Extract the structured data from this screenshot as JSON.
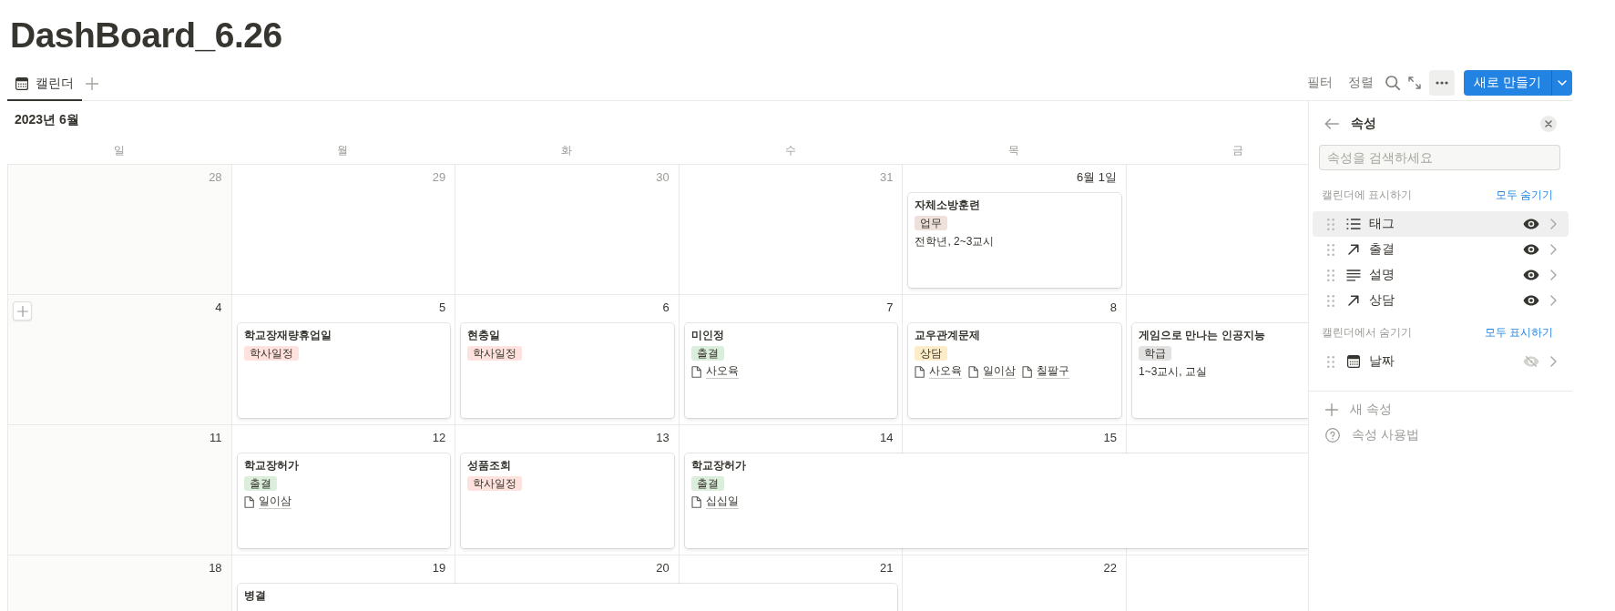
{
  "page": {
    "title": "DashBoard_6.26"
  },
  "view_tabs": [
    {
      "label": "캘린더",
      "selected": true
    }
  ],
  "toolbar": {
    "filter": "필터",
    "sort": "정렬",
    "new_button": "새로 만들기"
  },
  "calendar": {
    "month": "2023년 6월",
    "weekdays": [
      "일",
      "월",
      "화",
      "수",
      "목",
      "금"
    ],
    "weeks": [
      {
        "days": [
          {
            "label": "28",
            "in_month": false,
            "hovered": false
          },
          {
            "label": "29",
            "in_month": false,
            "hovered": false
          },
          {
            "label": "30",
            "in_month": false,
            "hovered": false
          },
          {
            "label": "31",
            "in_month": false,
            "hovered": false
          },
          {
            "label": "6월 1일",
            "in_month": true,
            "hovered": false,
            "event": {
              "title": "자체소방훈련",
              "tag": {
                "label": "업무",
                "color": "#eee0da"
              },
              "note": "전학년, 2~3교시"
            }
          },
          {
            "covered": false
          }
        ]
      },
      {
        "days": [
          {
            "label": "4",
            "in_month": true,
            "hovered": true
          },
          {
            "label": "5",
            "in_month": true,
            "hovered": false,
            "event": {
              "title": "학교장재량휴업일",
              "tag": {
                "label": "학사일정",
                "color": "#ffe2dd"
              }
            }
          },
          {
            "label": "6",
            "in_month": true,
            "hovered": false,
            "covered": false,
            "event": {
              "title": "현충일",
              "tag": {
                "label": "학사일정",
                "color": "#ffe2dd"
              }
            }
          },
          {
            "label": "7",
            "in_month": true,
            "hovered": false,
            "covered": false,
            "event": {
              "title": "미인정",
              "tag": {
                "label": "출결",
                "color": "#dbeddb"
              },
              "links": [
                "사오육"
              ]
            }
          },
          {
            "label": "8",
            "in_month": true,
            "hovered": false,
            "covered": false,
            "event": {
              "title": "교우관계문제",
              "tag": {
                "label": "상담",
                "color": "#fdecc8"
              },
              "links": [
                "사오육",
                "일이삼",
                "칠팔구"
              ]
            }
          },
          {
            "covered": false,
            "event": {
              "title": "게임으로 만나는 인공지능",
              "tag": {
                "label": "학급",
                "color": "#e3e2e0"
              },
              "note": "1~3교시, 교실"
            }
          }
        ]
      },
      {
        "days": [
          {
            "label": "11",
            "in_month": true,
            "hovered": false
          },
          {
            "label": "12",
            "in_month": true,
            "hovered": false,
            "event": {
              "title": "학교장허가",
              "tag": {
                "label": "출결",
                "color": "#dbeddb"
              },
              "links": [
                "일이삼"
              ]
            }
          },
          {
            "label": "13",
            "in_month": true,
            "hovered": false,
            "covered": false,
            "event": {
              "title": "성품조회",
              "tag": {
                "label": "학사일정",
                "color": "#ffe2dd"
              }
            }
          },
          {
            "label": "14",
            "in_month": true,
            "hovered": false,
            "covered": false,
            "event": {
              "title": "학교장허가",
              "tag": {
                "label": "출결",
                "color": "#dbeddb"
              },
              "links": [
                "십십일"
              ]
            }
          },
          {
            "label": "15",
            "in_month": true,
            "hovered": false,
            "covered": true
          },
          {
            "covered": true
          }
        ]
      },
      {
        "days": [
          {
            "label": "18",
            "in_month": true,
            "hovered": false
          },
          {
            "label": "19",
            "in_month": true,
            "hovered": false,
            "event": {
              "title": "병결"
            }
          },
          {
            "label": "20",
            "in_month": true,
            "hovered": false,
            "covered": true
          },
          {
            "label": "21",
            "in_month": true,
            "hovered": false,
            "covered": true
          },
          {
            "label": "22",
            "in_month": true,
            "hovered": false,
            "covered": false
          }
        ]
      }
    ]
  },
  "properties_panel": {
    "title": "속성",
    "search": {
      "placeholder": "속성을 검색하세요"
    },
    "sections": [
      {
        "label": "캘린더에 표시하기",
        "action": "모두 숨기기",
        "items": [
          {
            "name": "태그",
            "kind": "multi_select",
            "visible": true,
            "hovered": true
          },
          {
            "name": "출결",
            "kind": "relation",
            "visible": true,
            "hovered": false
          },
          {
            "name": "설명",
            "kind": "text",
            "visible": true,
            "hovered": false
          },
          {
            "name": "상담",
            "kind": "relation",
            "visible": true,
            "hovered": false
          }
        ]
      },
      {
        "label": "캘린더에서 숨기기",
        "action": "모두 표시하기",
        "items": [
          {
            "name": "날짜",
            "kind": "date",
            "visible": false,
            "hovered": false
          }
        ]
      }
    ],
    "footer": [
      {
        "label": "새 속성",
        "kind": "add"
      },
      {
        "label": "속성 사용법",
        "kind": "help"
      }
    ]
  }
}
